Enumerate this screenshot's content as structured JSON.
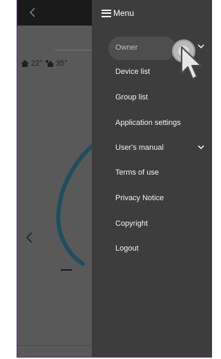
{
  "app": {
    "temps": [
      {
        "icon": "home-temperature-icon",
        "value": "22°"
      },
      {
        "icon": "outdoor-temperature-icon",
        "value": "35°"
      }
    ]
  },
  "menu": {
    "title": "Menu",
    "items": [
      {
        "label": "Owner",
        "has_chevron": true
      },
      {
        "label": "Device list"
      },
      {
        "label": "Group list"
      },
      {
        "label": "Application settings"
      },
      {
        "label": "User's manual",
        "has_chevron": true
      },
      {
        "label": "Terms of use"
      },
      {
        "label": "Privacy Notice"
      },
      {
        "label": "Copyright"
      },
      {
        "label": "Logout"
      }
    ]
  },
  "colors": {
    "drawer": "#3d3d3d",
    "overlay": "#595959",
    "gauge": "#1e4f5e",
    "frame_border": "#5d3a78"
  }
}
